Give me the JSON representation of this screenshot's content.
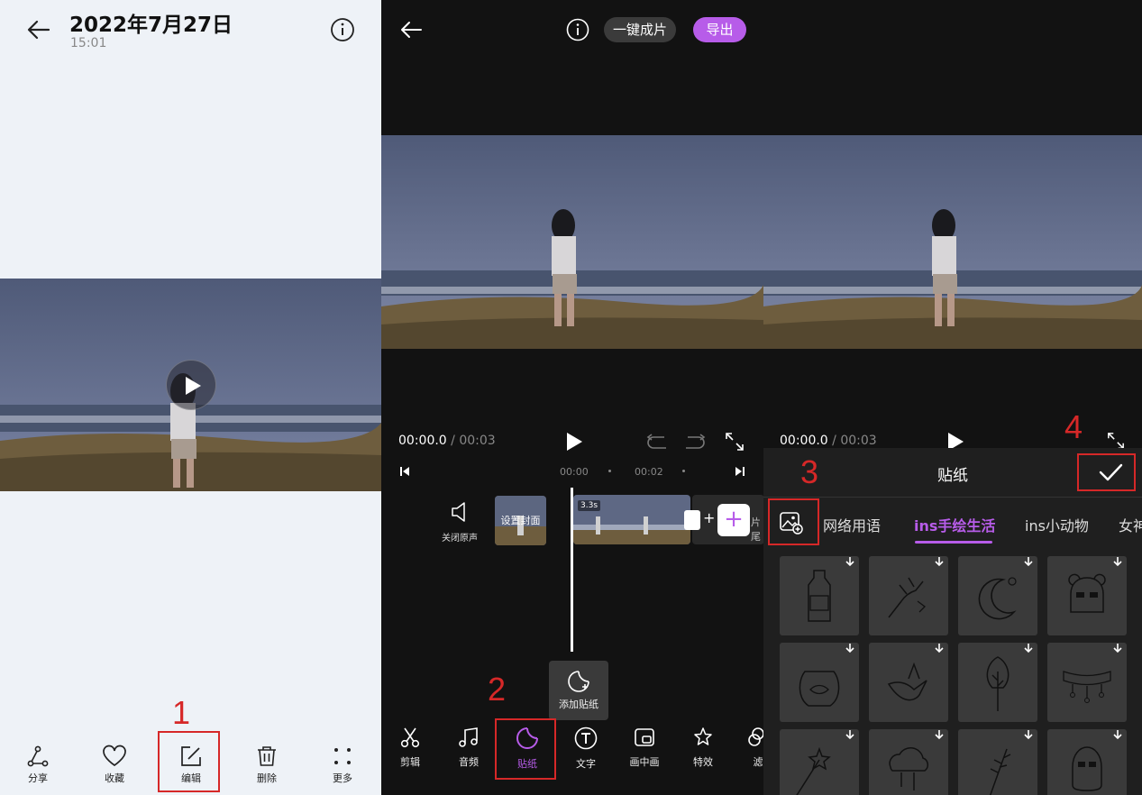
{
  "gallery": {
    "date": "2022年7月27日",
    "time": "15:01",
    "actions": [
      {
        "label": "分享",
        "icon": "share-icon"
      },
      {
        "label": "收藏",
        "icon": "heart-icon"
      },
      {
        "label": "编辑",
        "icon": "edit-icon"
      },
      {
        "label": "删除",
        "icon": "trash-icon"
      },
      {
        "label": "更多",
        "icon": "more-icon"
      }
    ]
  },
  "editor": {
    "one_click_label": "一键成片",
    "export_label": "导出",
    "timecode_current": "00:00.0",
    "timecode_total": " / 00:03",
    "ticks": [
      "00:00",
      "00:02"
    ],
    "mute_label": "关闭原声",
    "cover_label": "设置封面",
    "clip_duration": "3.3s",
    "ending_label": "片尾",
    "add_sticker_label": "添加贴纸",
    "tools": [
      {
        "label": "剪辑",
        "icon": "scissors-icon"
      },
      {
        "label": "音频",
        "icon": "music-icon"
      },
      {
        "label": "贴纸",
        "icon": "sticker-icon"
      },
      {
        "label": "文字",
        "icon": "text-icon"
      },
      {
        "label": "画中画",
        "icon": "pip-icon"
      },
      {
        "label": "特效",
        "icon": "effects-icon"
      },
      {
        "label": "滤",
        "icon": "filter-icon"
      }
    ]
  },
  "sticker_panel": {
    "timecode_current": "00:00.0",
    "timecode_total": " / 00:03",
    "title": "贴纸",
    "tabs": [
      "网络用语",
      "ins手绘生活",
      "ins小动物",
      "女神"
    ],
    "active_tab": "ins手绘生活",
    "stickers": [
      "bottle-sticker",
      "hand-sticker",
      "moon-sticker",
      "bear-sticker",
      "fishbowl-sticker",
      "bird-sticker",
      "tree-sticker",
      "banner-sticker",
      "wand-sticker",
      "cloud-sticker",
      "leaf-sticker",
      "icecream-sticker"
    ]
  },
  "annotations": [
    "1",
    "2",
    "3",
    "4"
  ],
  "colors": {
    "accent": "#b75ce9",
    "annotation": "#d62828"
  }
}
